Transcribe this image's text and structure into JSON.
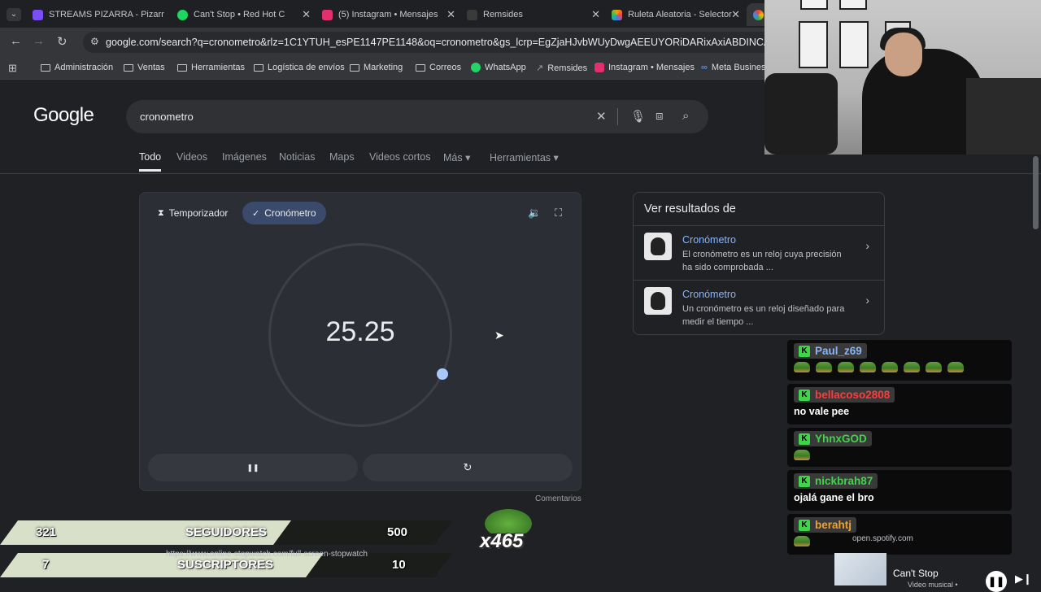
{
  "browser": {
    "tabs": [
      {
        "title": "STREAMS PIZARRA - Pizarr",
        "color": "#7b4df5"
      },
      {
        "title": "Can't Stop • Red Hot C",
        "color": "#1ed760"
      },
      {
        "title": "(5) Instagram • Mensajes",
        "color": "#e1306c"
      },
      {
        "title": "Remsides",
        "color": "#3a3a3a"
      },
      {
        "title": "Ruleta Aleatoria - Selector",
        "color": "#f59e0b"
      }
    ],
    "url": "google.com/search?q=cronometro&rlz=1C1YTUH_esPE1147PE1148&oq=cronometro&gs_lcrp=EgZjaHJvbWUyDwgAEEUYORiDARixAxiABDINCAEQABiDARixA",
    "bookmarks": [
      {
        "label": "Administración",
        "type": "folder"
      },
      {
        "label": "Ventas",
        "type": "folder"
      },
      {
        "label": "Herramientas",
        "type": "folder"
      },
      {
        "label": "Logística de envíos",
        "type": "folder"
      },
      {
        "label": "Marketing",
        "type": "folder"
      },
      {
        "label": "Correos",
        "type": "folder"
      },
      {
        "label": "WhatsApp",
        "type": "whatsapp"
      },
      {
        "label": "Remsides",
        "type": "remsides"
      },
      {
        "label": "Instagram • Mensajes",
        "type": "instagram"
      },
      {
        "label": "Meta Business",
        "type": "meta"
      }
    ]
  },
  "google": {
    "logo": "Google",
    "query": "cronometro",
    "filters": [
      "Todo",
      "Videos",
      "Imágenes",
      "Noticias",
      "Maps",
      "Videos cortos",
      "Más ▾",
      "Herramientas ▾"
    ],
    "active_filter": "Todo"
  },
  "stopwatch": {
    "tab_timer": "Temporizador",
    "tab_stopwatch": "Cronómetro",
    "time": "25.25",
    "pause_glyph": "❚❚",
    "reset_glyph": "↻",
    "comments": "Comentarios"
  },
  "panel": {
    "title": "Ver resultados de",
    "results": [
      {
        "title": "Cronómetro",
        "desc": "El cronómetro es un reloj cuya precisión ha sido comprobada ..."
      },
      {
        "title": "Cronómetro",
        "desc": "Un cronómetro es un reloj diseñado para medir el tiempo ..."
      }
    ]
  },
  "chat": {
    "messages": [
      {
        "user": "Paul_z69",
        "color": "#8ab4f8",
        "text": "",
        "emotes": 8
      },
      {
        "user": "bellacoso2808",
        "color": "#ff3b3b",
        "text": "no vale pee",
        "emotes": 0
      },
      {
        "user": "YhnxGOD",
        "color": "#3fd44a",
        "text": "",
        "emotes": 1
      },
      {
        "user": "nickbrah87",
        "color": "#3fd44a",
        "text": "ojalá gane el bro",
        "emotes": 0
      },
      {
        "user": "berahtj",
        "color": "#f0a030",
        "text": "",
        "emotes": 1
      }
    ]
  },
  "overlay": {
    "followers_current": "321",
    "followers_label": "SEGUIDORES",
    "followers_goal": "500",
    "subs_current": "7",
    "subs_label": "SUSCRIPTORES",
    "subs_goal": "10",
    "multiplier": "x465",
    "behind_url": "https://www.online-stopwatch.com/full-screen-stopwatch"
  },
  "spotify": {
    "host": "open.spotify.com",
    "title": "Can't Stop",
    "subtitle": "Video musical •"
  }
}
